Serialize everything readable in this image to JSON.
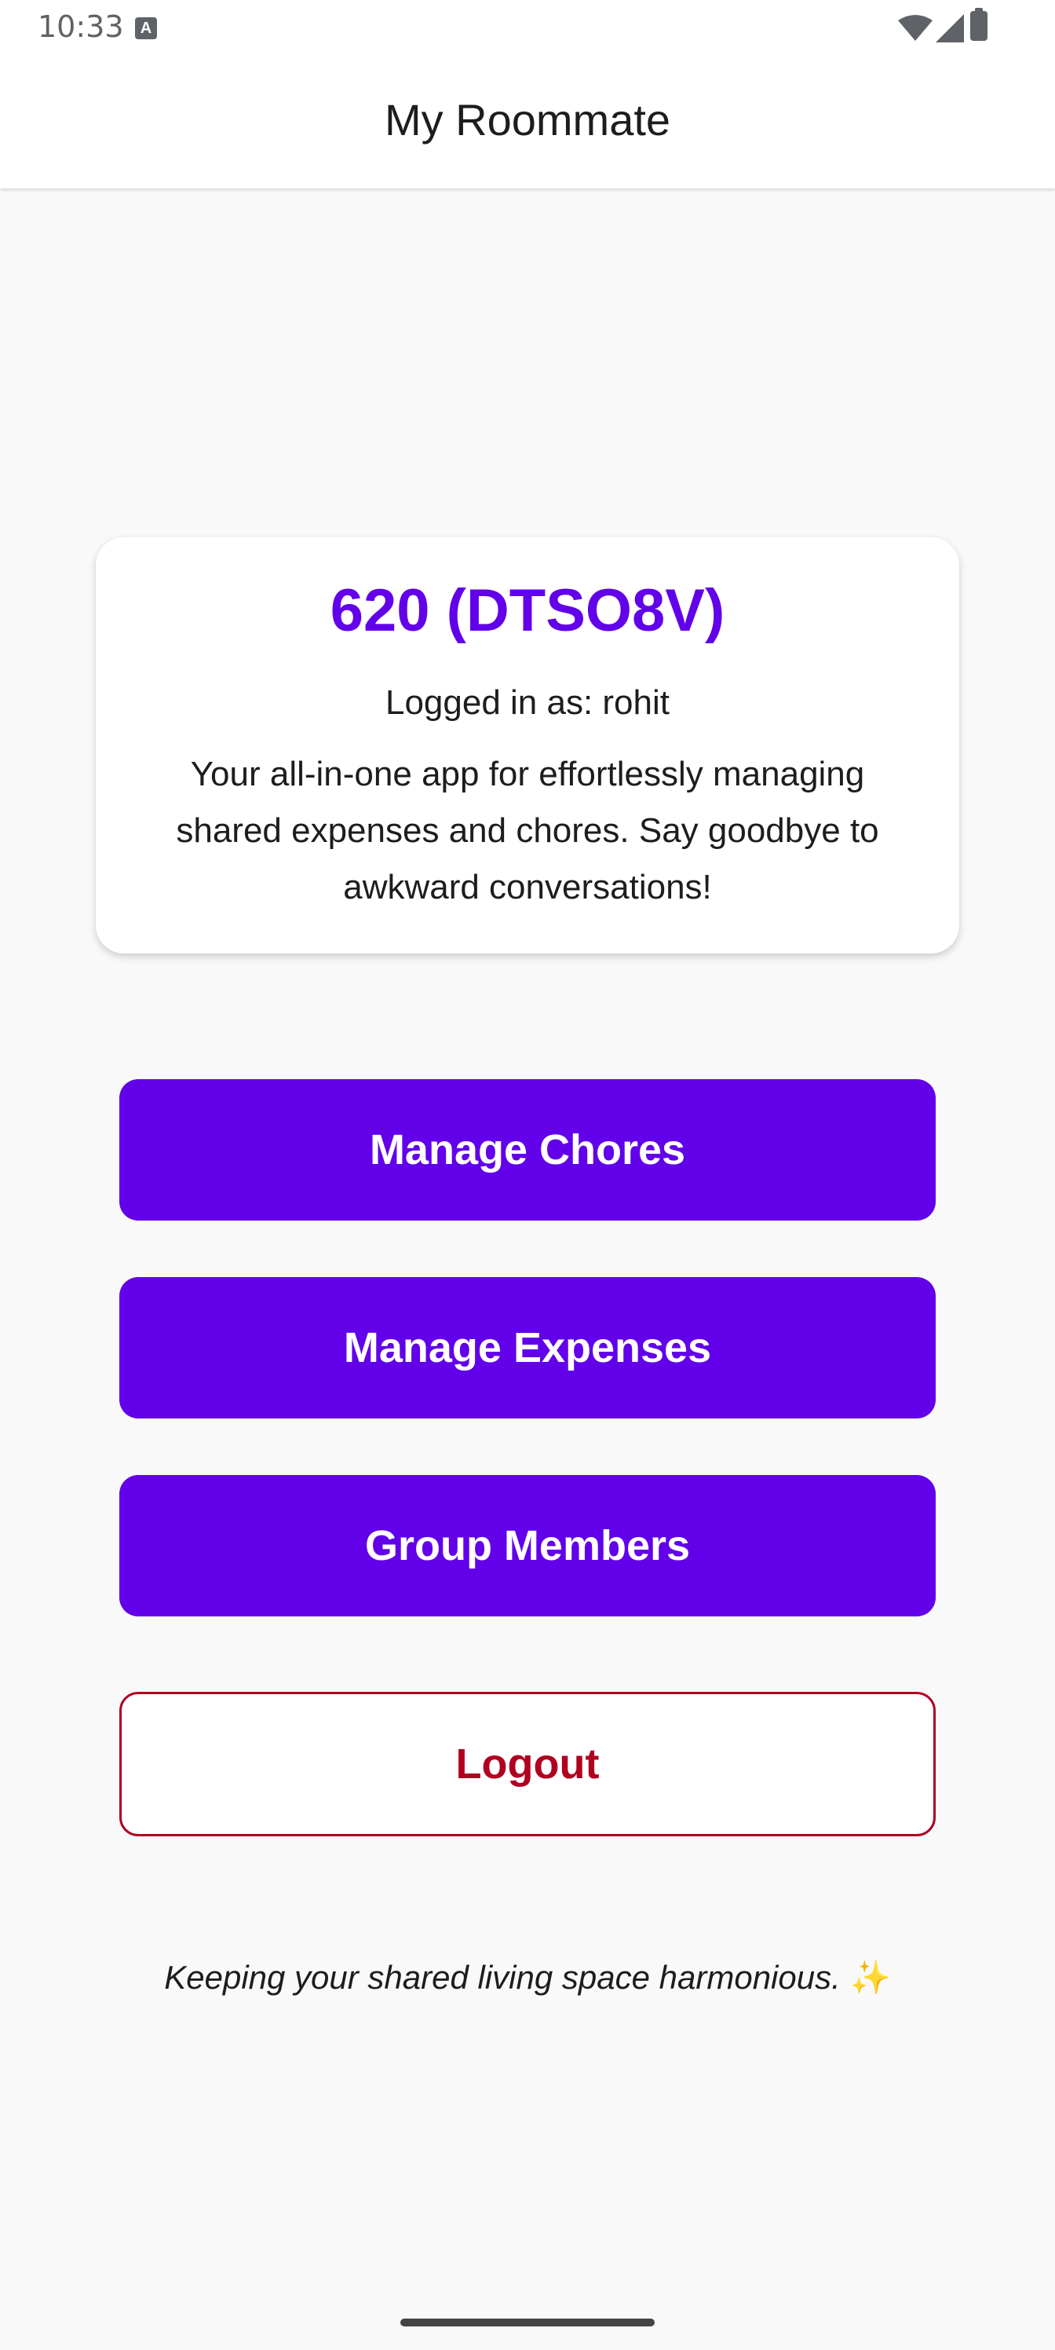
{
  "status_bar": {
    "time": "10:33"
  },
  "app_bar": {
    "title": "My Roommate"
  },
  "card": {
    "group_title": "620 (DTSO8V)",
    "logged_in": "Logged in as: rohit",
    "description": "Your all-in-one app for effortlessly managing shared expenses and chores. Say goodbye to awkward conversations!"
  },
  "buttons": {
    "chores": "Manage Chores",
    "expenses": "Manage Expenses",
    "members": "Group Members",
    "logout": "Logout"
  },
  "footer": {
    "text": "Keeping your shared living space harmonious.",
    "emoji": "✨"
  },
  "colors": {
    "primary": "#6200ea",
    "logout": "#b00020",
    "background": "#f9f9f9"
  }
}
